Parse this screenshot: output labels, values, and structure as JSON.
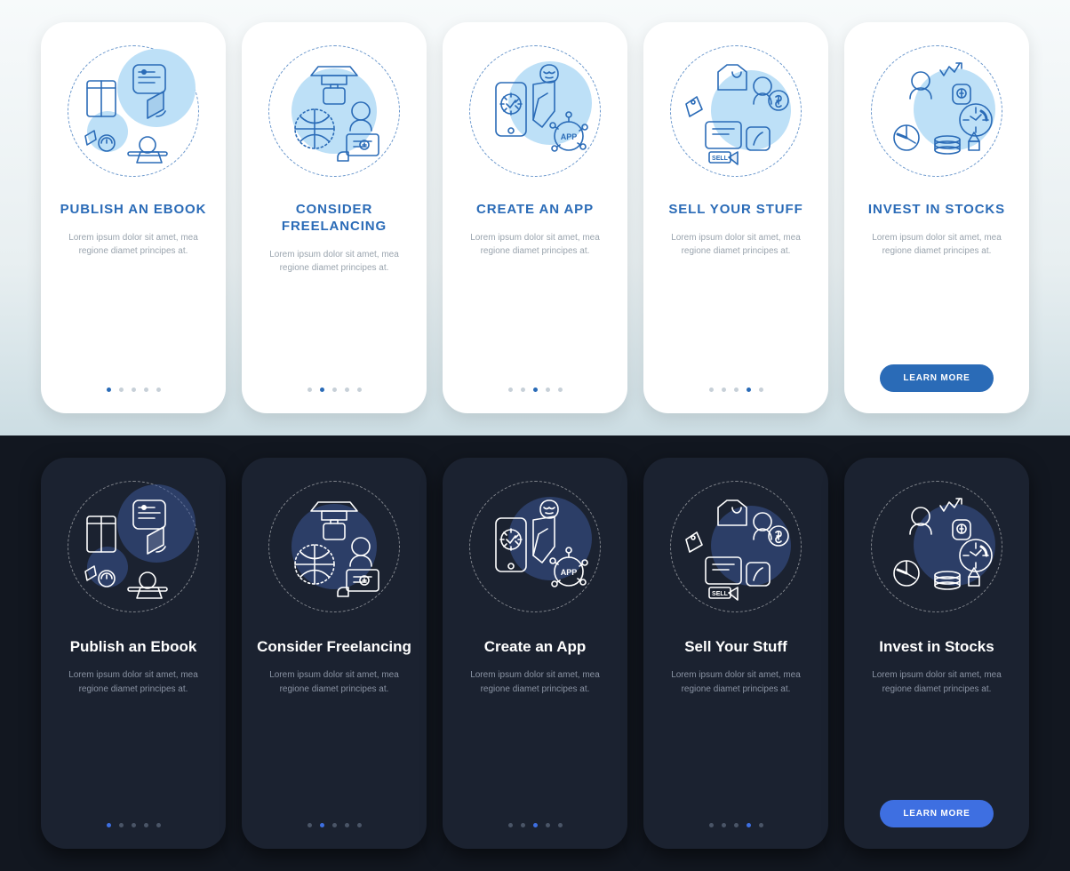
{
  "description": "Lorem ipsum dolor sit amet, mea regione diamet principes at.",
  "cta_label": "LEARN MORE",
  "light_cards": [
    {
      "title": "PUBLISH AN EBOOK",
      "active_dot": 0,
      "total_dots": 5
    },
    {
      "title": "CONSIDER FREELANCING",
      "active_dot": 1,
      "total_dots": 5
    },
    {
      "title": "CREATE AN APP",
      "active_dot": 2,
      "total_dots": 5
    },
    {
      "title": "SELL YOUR STUFF",
      "active_dot": 3,
      "total_dots": 5
    },
    {
      "title": "INVEST IN STOCKS",
      "active_dot": -1,
      "total_dots": 0
    }
  ],
  "dark_cards": [
    {
      "title": "Publish an Ebook",
      "active_dot": 0,
      "total_dots": 5
    },
    {
      "title": "Consider Freelancing",
      "active_dot": 1,
      "total_dots": 5
    },
    {
      "title": "Create an App",
      "active_dot": 2,
      "total_dots": 5
    },
    {
      "title": "Sell Your Stuff",
      "active_dot": 3,
      "total_dots": 5
    },
    {
      "title": "Invest in Stocks",
      "active_dot": -1,
      "total_dots": 0
    }
  ],
  "colors": {
    "accent_light": "#2A6BB7",
    "accent_dark": "#3E6FE1",
    "bg_dark": "#121720",
    "card_dark": "#1B2230"
  }
}
